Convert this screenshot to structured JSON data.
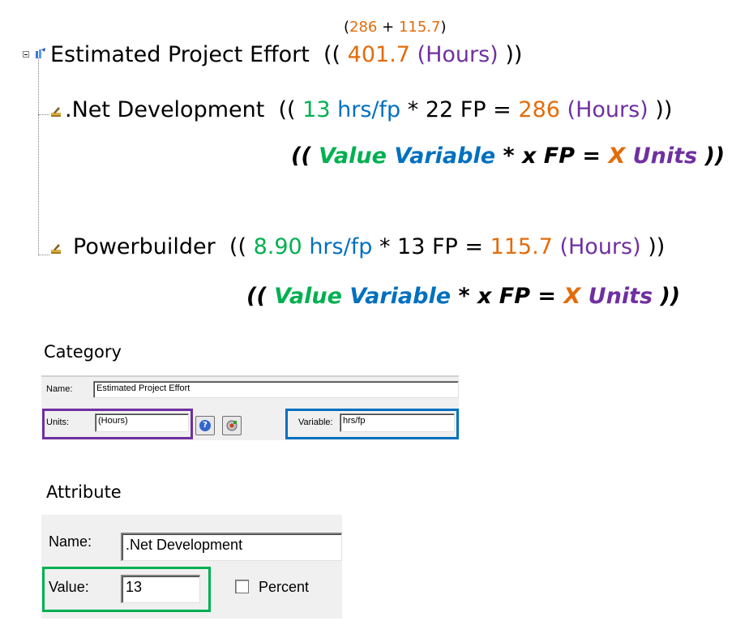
{
  "tree": {
    "root": {
      "sum": {
        "open": "(",
        "a": "286",
        "plus": "+",
        "b": "115.7",
        "close": ")"
      },
      "label": "Estimated Project Effort",
      "open": "((",
      "value": "401.7",
      "units": "(Hours)",
      "close": "))"
    },
    "items": [
      {
        "label": ".Net Development",
        "open": "((",
        "rate": "13",
        "rate_unit": "hrs/fp",
        "times": "* 22 FP =",
        "result": "286",
        "units": "(Hours)",
        "close": "))",
        "formula": {
          "open": "((",
          "value": "Value",
          "variable": "Variable",
          "mid": "* x FP =",
          "x": "X",
          "units": "Units",
          "close": "))"
        }
      },
      {
        "label": "Powerbuilder",
        "open": "((",
        "rate": "8.90",
        "rate_unit": "hrs/fp",
        "times": "* 13 FP =",
        "result": "115.7",
        "units": "(Hours)",
        "close": "))",
        "formula": {
          "open": "((",
          "value": "Value",
          "variable": "Variable",
          "mid": "* x FP =",
          "x": "X",
          "units": "Units",
          "close": "))"
        }
      }
    ]
  },
  "category": {
    "heading": "Category",
    "name_label": "Name:",
    "name_value": "Estimated Project Effort",
    "units_label": "Units:",
    "units_value": "(Hours)",
    "variable_label": "Variable:",
    "variable_value": "hrs/fp",
    "help_icon": "help-icon",
    "options_icon": "options-icon"
  },
  "attribute": {
    "heading": "Attribute",
    "name_label": "Name:",
    "name_value": ".Net Development",
    "value_label": "Value:",
    "value_value": "13",
    "percent_label": "Percent",
    "percent_checked": false
  },
  "colors": {
    "orange": "#e36c0a",
    "purple": "#7030a0",
    "green": "#00b050",
    "blue": "#0070c0",
    "panel_bg": "#f0f0f0"
  }
}
